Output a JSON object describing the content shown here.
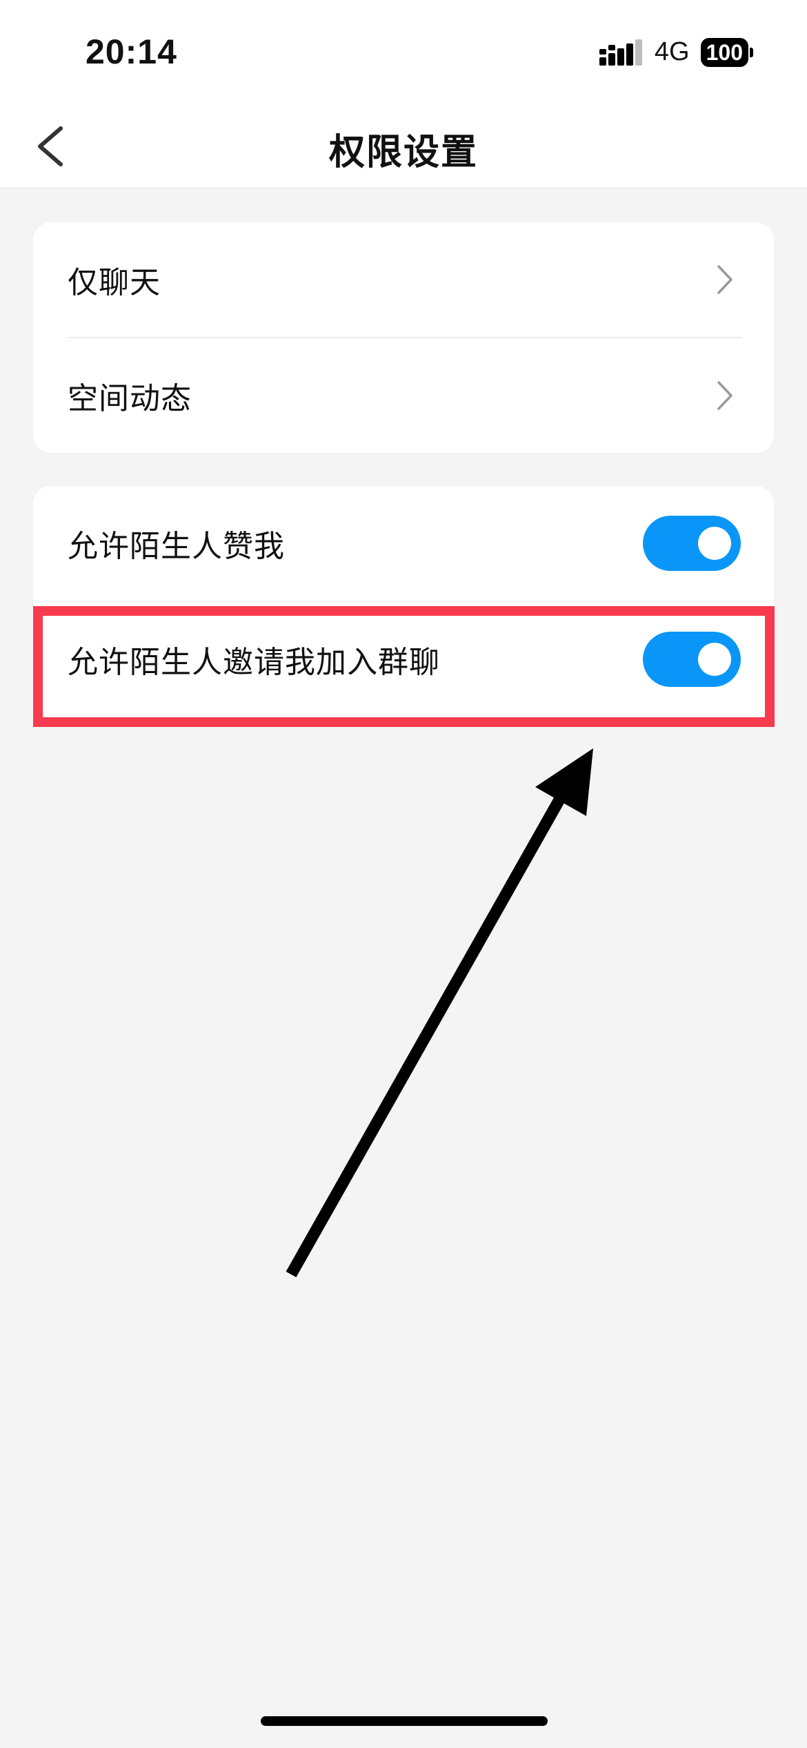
{
  "status_bar": {
    "time": "20:14",
    "network": "4G",
    "battery": "100"
  },
  "header": {
    "title": "权限设置",
    "back_icon": "chevron-left-icon"
  },
  "group_1": {
    "items": [
      {
        "label": "仅聊天",
        "icon": "chevron-right-icon"
      },
      {
        "label": "空间动态",
        "icon": "chevron-right-icon"
      }
    ]
  },
  "group_2": {
    "items": [
      {
        "label": "允许陌生人赞我",
        "enabled": true
      },
      {
        "label": "允许陌生人邀请我加入群聊",
        "enabled": true
      }
    ]
  },
  "colors": {
    "toggle_on": "#0a96f8",
    "highlight": "#f73a4e",
    "page_background": "#f4f4f4"
  }
}
